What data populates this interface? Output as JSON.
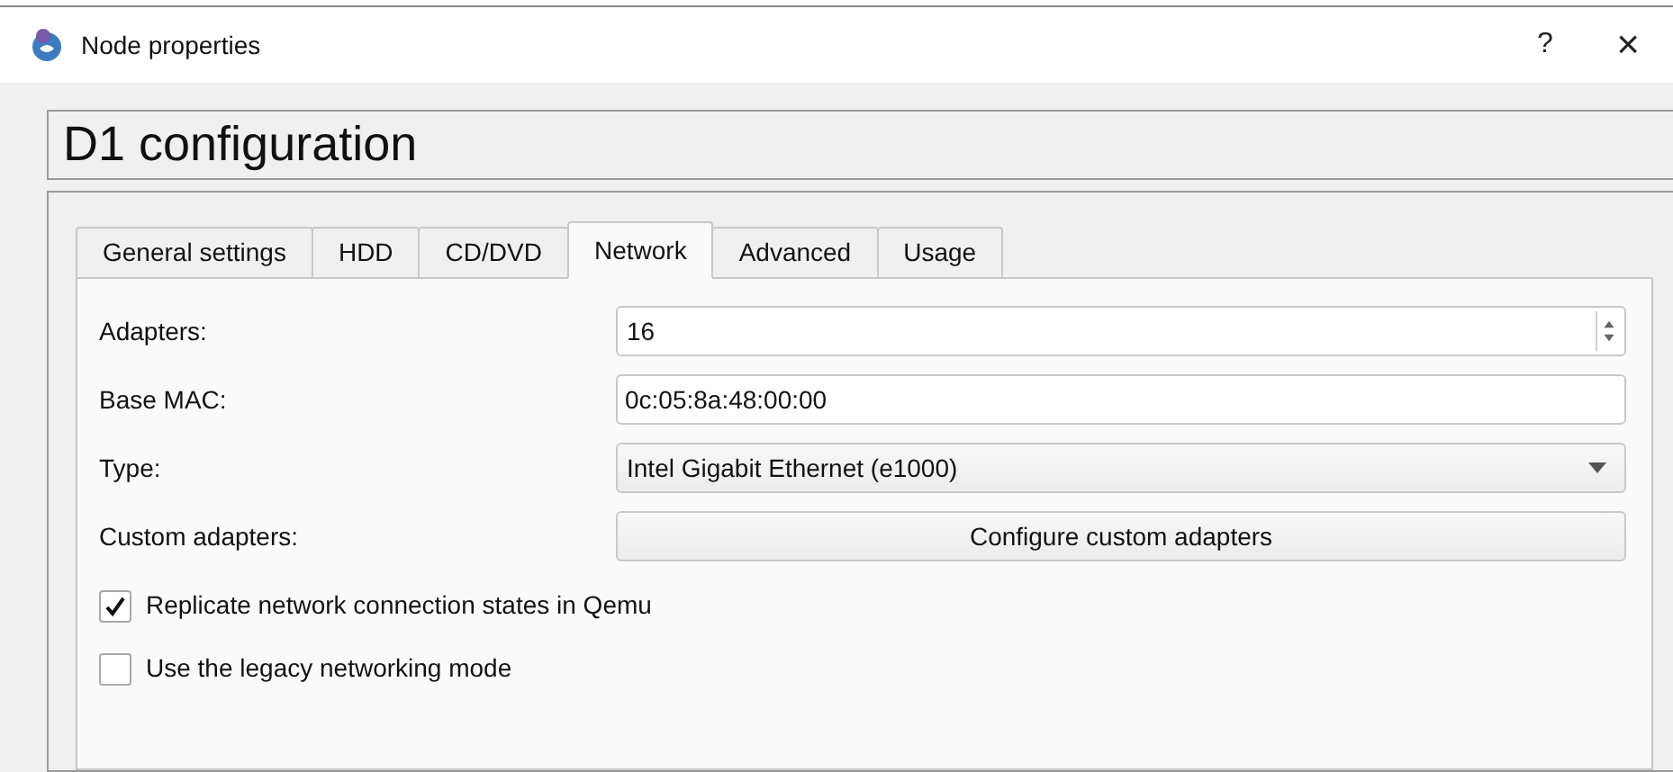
{
  "window": {
    "title": "Node properties",
    "help": "?",
    "close": "×"
  },
  "heading": "D1 configuration",
  "tabs": [
    {
      "label": "General settings",
      "selected": false
    },
    {
      "label": "HDD",
      "selected": false
    },
    {
      "label": "CD/DVD",
      "selected": false
    },
    {
      "label": "Network",
      "selected": true
    },
    {
      "label": "Advanced",
      "selected": false
    },
    {
      "label": "Usage",
      "selected": false
    }
  ],
  "form": [
    {
      "kind": "spin",
      "label": "Adapters:",
      "value": "16"
    },
    {
      "kind": "text",
      "label": "Base MAC:",
      "value": "0c:05:8a:48:00:00"
    },
    {
      "kind": "select",
      "label": "Type:",
      "value": "Intel Gigabit Ethernet (e1000)"
    },
    {
      "kind": "button",
      "label": "Custom adapters:",
      "value": "Configure custom adapters"
    }
  ],
  "checkboxes": [
    {
      "label": "Replicate network connection states in Qemu",
      "checked": true
    },
    {
      "label": "Use the legacy networking mode",
      "checked": false
    }
  ]
}
